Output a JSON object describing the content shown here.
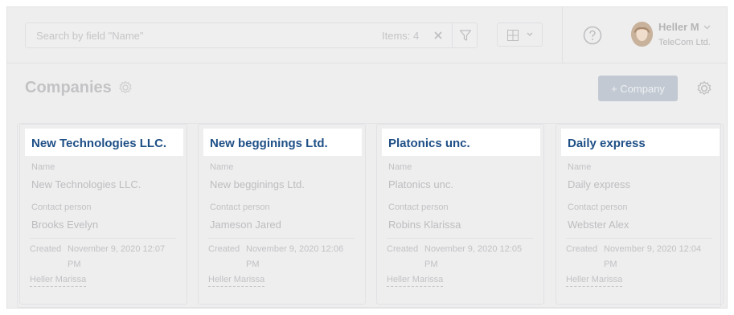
{
  "search": {
    "placeholder": "Search by field \"Name\"",
    "value": "",
    "items_count": "Items: 4"
  },
  "user": {
    "name": "Heller M",
    "company": "TeleCom Ltd."
  },
  "page": {
    "title": "Companies",
    "add_button": "+ Company"
  },
  "colors": {
    "title_link": "#1e4f86",
    "primary_button": "#c2c9d2",
    "background": "#eeeeef"
  },
  "icons": [
    "clear-icon",
    "filter-icon",
    "grid-view-icon",
    "chevron-down-icon",
    "help-icon",
    "gear-icon"
  ],
  "cards": [
    {
      "title": "New Technologies LLC.",
      "name_label": "Name",
      "name": "New Technologies LLC.",
      "contact_label": "Contact person",
      "contact": "Brooks Evelyn",
      "created_label": "Created",
      "created": "November 9, 2020 12:07 PM",
      "author": "Heller Marissa"
    },
    {
      "title": "New begginings Ltd.",
      "name_label": "Name",
      "name": "New begginings Ltd.",
      "contact_label": "Contact person",
      "contact": "Jameson Jared",
      "created_label": "Created",
      "created": "November 9, 2020 12:06 PM",
      "author": "Heller Marissa"
    },
    {
      "title": "Platonics unc.",
      "name_label": "Name",
      "name": "Platonics unc.",
      "contact_label": "Contact person",
      "contact": "Robins Klarissa",
      "created_label": "Created",
      "created": "November 9, 2020 12:05 PM",
      "author": "Heller Marissa"
    },
    {
      "title": "Daily express",
      "name_label": "Name",
      "name": "Daily express",
      "contact_label": "Contact person",
      "contact": "Webster Alex",
      "created_label": "Created",
      "created": "November 9, 2020 12:04 PM",
      "author": "Heller Marissa"
    }
  ]
}
